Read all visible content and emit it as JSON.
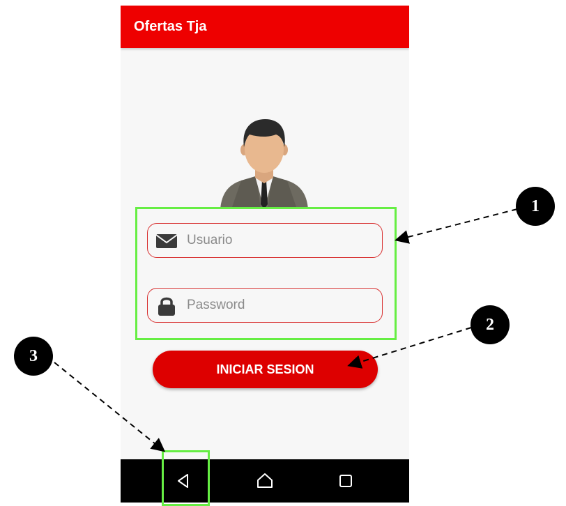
{
  "app": {
    "title": "Ofertas Tja"
  },
  "login": {
    "username_placeholder": "Usuario",
    "password_placeholder": "Password",
    "submit_label": "INICIAR SESION"
  },
  "icons": {
    "avatar": "user-avatar-icon",
    "username": "envelope-icon",
    "password": "lock-icon",
    "nav_back": "back-triangle-icon",
    "nav_home": "home-icon",
    "nav_recent": "recent-apps-icon"
  },
  "annotations": {
    "callouts": [
      "1",
      "2",
      "3"
    ]
  },
  "colors": {
    "appbar": "#ee0000",
    "button": "#dd0000",
    "field_border": "#d83030",
    "highlight": "#66ee44",
    "navbar": "#000000"
  }
}
